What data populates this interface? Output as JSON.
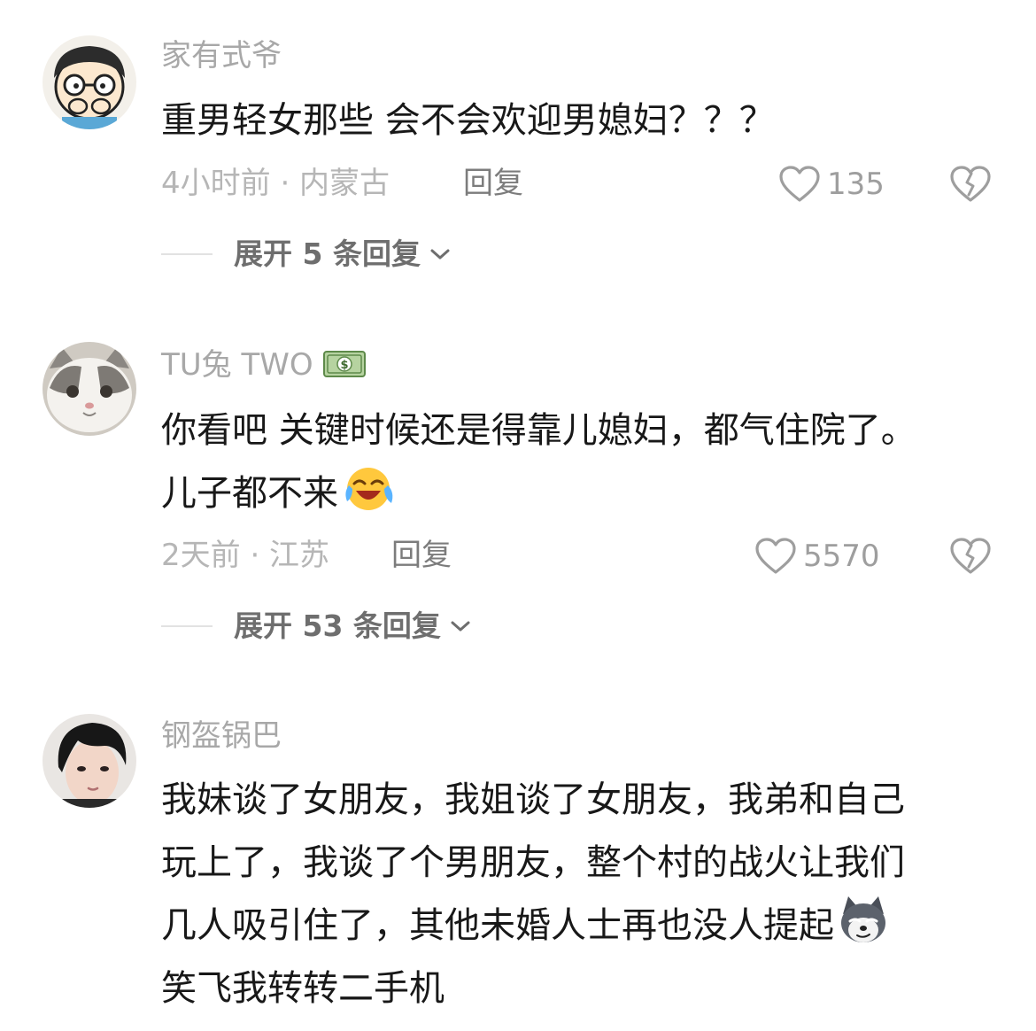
{
  "comments": [
    {
      "username": "家有式爷",
      "text_lines": [
        "重男轻女那些  会不会欢迎男媳妇？？？"
      ],
      "time_location": "4小时前 · 内蒙古",
      "reply_label": "回复",
      "likes": "135",
      "expand_label": "展开 5 条回复",
      "avatar_icon": "boy-face-covering-mouth-avatar"
    },
    {
      "username": "TU兔 TWO",
      "username_emoji": "money-bill-emoji",
      "text_lines": [
        "你看吧 关键时候还是得靠儿媳妇，都气住院了。",
        "儿子都不来"
      ],
      "text_emoji": "crying-laughing-emoji",
      "time_location": "2天前 · 江苏",
      "reply_label": "回复",
      "likes": "5570",
      "expand_label": "展开 53 条回复",
      "avatar_icon": "white-grey-cat-avatar"
    },
    {
      "username": "钢盔锅巴",
      "text_lines": [
        "我妹谈了女朋友，我姐谈了女朋友，我弟和自己",
        "玩上了，我谈了个男朋友，整个村的战火让我们",
        "几人吸引住了，其他未婚人士再也没人提起",
        "笑飞我转转二手机"
      ],
      "text_emoji": "smug-husky-emoji",
      "avatar_icon": "young-man-photo-avatar"
    }
  ],
  "colors": {
    "username": "#a8a8a8",
    "text": "#181818",
    "meta": "#b6b6b6",
    "reply": "#7c7c7c",
    "like": "#9e9e9e",
    "expand": "#6e6e6e"
  }
}
